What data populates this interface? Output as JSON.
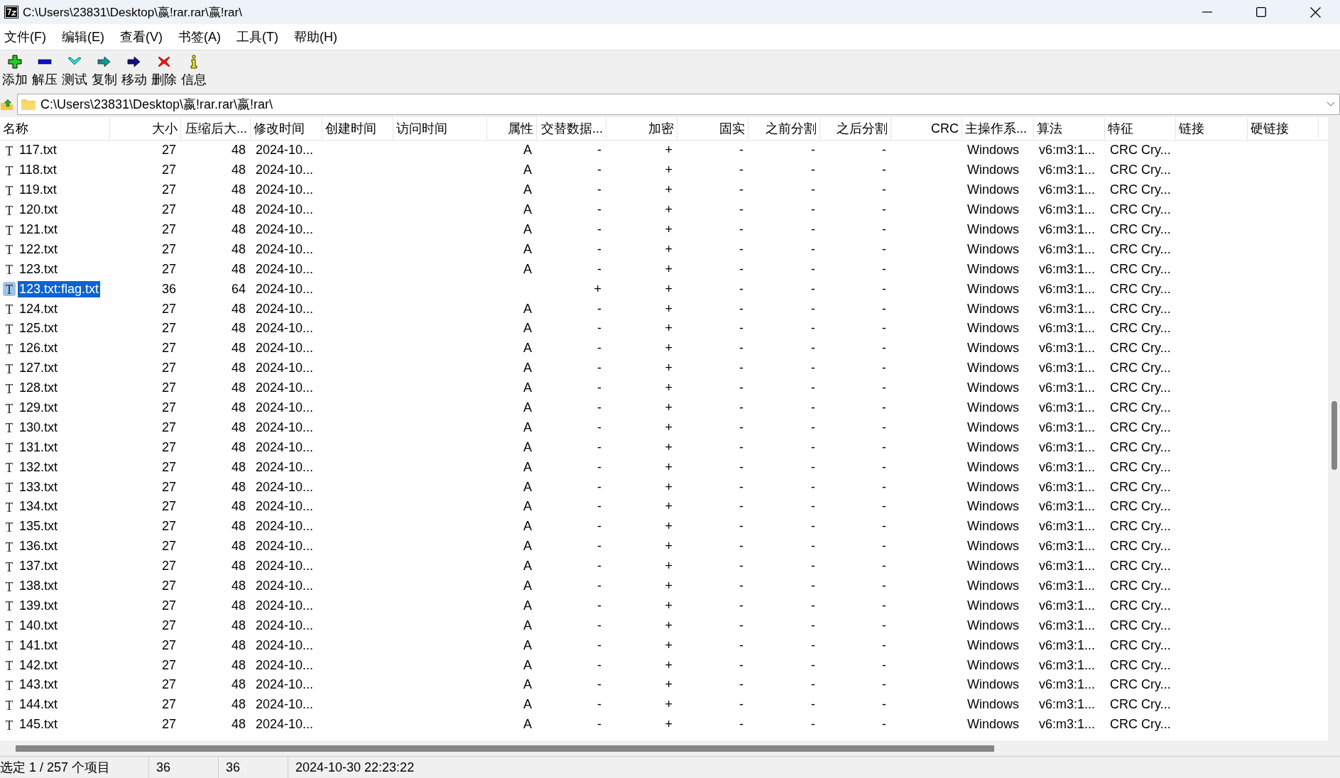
{
  "window": {
    "title": "C:\\Users\\23831\\Desktop\\嬴!rar.rar\\嬴!rar\\"
  },
  "menu": [
    "文件(F)",
    "编辑(E)",
    "查看(V)",
    "书签(A)",
    "工具(T)",
    "帮助(H)"
  ],
  "toolbar": [
    {
      "kind": "add",
      "label": "添加"
    },
    {
      "kind": "extract",
      "label": "解压"
    },
    {
      "kind": "test",
      "label": "测试"
    },
    {
      "kind": "copy",
      "label": "复制"
    },
    {
      "kind": "move",
      "label": "移动"
    },
    {
      "kind": "delete",
      "label": "删除"
    },
    {
      "kind": "info",
      "label": "信息"
    }
  ],
  "address": {
    "value": "C:\\Users\\23831\\Desktop\\嬴!rar.rar\\嬴!rar\\"
  },
  "table": {
    "columns": [
      "名称",
      "大小",
      "压缩后大...",
      "修改时间",
      "创建时间",
      "访问时间",
      "属性",
      "交替数据...",
      "加密",
      "固实",
      "之前分割",
      "之后分割",
      "CRC",
      "主操作系...",
      "算法",
      "特征",
      "链接",
      "硬链接"
    ],
    "rows": [
      {
        "name": "117.txt",
        "size": "27",
        "packed": "48",
        "modified": "2024-10...",
        "attributes": "A",
        "alternate": "-",
        "encrypted": "+",
        "solid": "-",
        "split_before": "-",
        "split_after": "-",
        "host_os": "Windows",
        "method": "v6:m3:1...",
        "characteristics": "CRC Cry...",
        "selected": false
      },
      {
        "name": "118.txt",
        "size": "27",
        "packed": "48",
        "modified": "2024-10...",
        "attributes": "A",
        "alternate": "-",
        "encrypted": "+",
        "solid": "-",
        "split_before": "-",
        "split_after": "-",
        "host_os": "Windows",
        "method": "v6:m3:1...",
        "characteristics": "CRC Cry...",
        "selected": false
      },
      {
        "name": "119.txt",
        "size": "27",
        "packed": "48",
        "modified": "2024-10...",
        "attributes": "A",
        "alternate": "-",
        "encrypted": "+",
        "solid": "-",
        "split_before": "-",
        "split_after": "-",
        "host_os": "Windows",
        "method": "v6:m3:1...",
        "characteristics": "CRC Cry...",
        "selected": false
      },
      {
        "name": "120.txt",
        "size": "27",
        "packed": "48",
        "modified": "2024-10...",
        "attributes": "A",
        "alternate": "-",
        "encrypted": "+",
        "solid": "-",
        "split_before": "-",
        "split_after": "-",
        "host_os": "Windows",
        "method": "v6:m3:1...",
        "characteristics": "CRC Cry...",
        "selected": false
      },
      {
        "name": "121.txt",
        "size": "27",
        "packed": "48",
        "modified": "2024-10...",
        "attributes": "A",
        "alternate": "-",
        "encrypted": "+",
        "solid": "-",
        "split_before": "-",
        "split_after": "-",
        "host_os": "Windows",
        "method": "v6:m3:1...",
        "characteristics": "CRC Cry...",
        "selected": false
      },
      {
        "name": "122.txt",
        "size": "27",
        "packed": "48",
        "modified": "2024-10...",
        "attributes": "A",
        "alternate": "-",
        "encrypted": "+",
        "solid": "-",
        "split_before": "-",
        "split_after": "-",
        "host_os": "Windows",
        "method": "v6:m3:1...",
        "characteristics": "CRC Cry...",
        "selected": false
      },
      {
        "name": "123.txt",
        "size": "27",
        "packed": "48",
        "modified": "2024-10...",
        "attributes": "A",
        "alternate": "-",
        "encrypted": "+",
        "solid": "-",
        "split_before": "-",
        "split_after": "-",
        "host_os": "Windows",
        "method": "v6:m3:1...",
        "characteristics": "CRC Cry...",
        "selected": false
      },
      {
        "name": "123.txt:flag.txt",
        "size": "36",
        "packed": "64",
        "modified": "2024-10...",
        "alternate": "+",
        "encrypted": "+",
        "solid": "-",
        "split_before": "-",
        "split_after": "-",
        "host_os": "Windows",
        "method": "v6:m3:1...",
        "characteristics": "CRC Cry...",
        "selected": true
      },
      {
        "name": "124.txt",
        "size": "27",
        "packed": "48",
        "modified": "2024-10...",
        "attributes": "A",
        "alternate": "-",
        "encrypted": "+",
        "solid": "-",
        "split_before": "-",
        "split_after": "-",
        "host_os": "Windows",
        "method": "v6:m3:1...",
        "characteristics": "CRC Cry...",
        "selected": false
      },
      {
        "name": "125.txt",
        "size": "27",
        "packed": "48",
        "modified": "2024-10...",
        "attributes": "A",
        "alternate": "-",
        "encrypted": "+",
        "solid": "-",
        "split_before": "-",
        "split_after": "-",
        "host_os": "Windows",
        "method": "v6:m3:1...",
        "characteristics": "CRC Cry...",
        "selected": false
      },
      {
        "name": "126.txt",
        "size": "27",
        "packed": "48",
        "modified": "2024-10...",
        "attributes": "A",
        "alternate": "-",
        "encrypted": "+",
        "solid": "-",
        "split_before": "-",
        "split_after": "-",
        "host_os": "Windows",
        "method": "v6:m3:1...",
        "characteristics": "CRC Cry...",
        "selected": false
      },
      {
        "name": "127.txt",
        "size": "27",
        "packed": "48",
        "modified": "2024-10...",
        "attributes": "A",
        "alternate": "-",
        "encrypted": "+",
        "solid": "-",
        "split_before": "-",
        "split_after": "-",
        "host_os": "Windows",
        "method": "v6:m3:1...",
        "characteristics": "CRC Cry...",
        "selected": false
      },
      {
        "name": "128.txt",
        "size": "27",
        "packed": "48",
        "modified": "2024-10...",
        "attributes": "A",
        "alternate": "-",
        "encrypted": "+",
        "solid": "-",
        "split_before": "-",
        "split_after": "-",
        "host_os": "Windows",
        "method": "v6:m3:1...",
        "characteristics": "CRC Cry...",
        "selected": false
      },
      {
        "name": "129.txt",
        "size": "27",
        "packed": "48",
        "modified": "2024-10...",
        "attributes": "A",
        "alternate": "-",
        "encrypted": "+",
        "solid": "-",
        "split_before": "-",
        "split_after": "-",
        "host_os": "Windows",
        "method": "v6:m3:1...",
        "characteristics": "CRC Cry...",
        "selected": false
      },
      {
        "name": "130.txt",
        "size": "27",
        "packed": "48",
        "modified": "2024-10...",
        "attributes": "A",
        "alternate": "-",
        "encrypted": "+",
        "solid": "-",
        "split_before": "-",
        "split_after": "-",
        "host_os": "Windows",
        "method": "v6:m3:1...",
        "characteristics": "CRC Cry...",
        "selected": false
      },
      {
        "name": "131.txt",
        "size": "27",
        "packed": "48",
        "modified": "2024-10...",
        "attributes": "A",
        "alternate": "-",
        "encrypted": "+",
        "solid": "-",
        "split_before": "-",
        "split_after": "-",
        "host_os": "Windows",
        "method": "v6:m3:1...",
        "characteristics": "CRC Cry...",
        "selected": false
      },
      {
        "name": "132.txt",
        "size": "27",
        "packed": "48",
        "modified": "2024-10...",
        "attributes": "A",
        "alternate": "-",
        "encrypted": "+",
        "solid": "-",
        "split_before": "-",
        "split_after": "-",
        "host_os": "Windows",
        "method": "v6:m3:1...",
        "characteristics": "CRC Cry...",
        "selected": false
      },
      {
        "name": "133.txt",
        "size": "27",
        "packed": "48",
        "modified": "2024-10...",
        "attributes": "A",
        "alternate": "-",
        "encrypted": "+",
        "solid": "-",
        "split_before": "-",
        "split_after": "-",
        "host_os": "Windows",
        "method": "v6:m3:1...",
        "characteristics": "CRC Cry...",
        "selected": false
      },
      {
        "name": "134.txt",
        "size": "27",
        "packed": "48",
        "modified": "2024-10...",
        "attributes": "A",
        "alternate": "-",
        "encrypted": "+",
        "solid": "-",
        "split_before": "-",
        "split_after": "-",
        "host_os": "Windows",
        "method": "v6:m3:1...",
        "characteristics": "CRC Cry...",
        "selected": false
      },
      {
        "name": "135.txt",
        "size": "27",
        "packed": "48",
        "modified": "2024-10...",
        "attributes": "A",
        "alternate": "-",
        "encrypted": "+",
        "solid": "-",
        "split_before": "-",
        "split_after": "-",
        "host_os": "Windows",
        "method": "v6:m3:1...",
        "characteristics": "CRC Cry...",
        "selected": false
      },
      {
        "name": "136.txt",
        "size": "27",
        "packed": "48",
        "modified": "2024-10...",
        "attributes": "A",
        "alternate": "-",
        "encrypted": "+",
        "solid": "-",
        "split_before": "-",
        "split_after": "-",
        "host_os": "Windows",
        "method": "v6:m3:1...",
        "characteristics": "CRC Cry...",
        "selected": false
      },
      {
        "name": "137.txt",
        "size": "27",
        "packed": "48",
        "modified": "2024-10...",
        "attributes": "A",
        "alternate": "-",
        "encrypted": "+",
        "solid": "-",
        "split_before": "-",
        "split_after": "-",
        "host_os": "Windows",
        "method": "v6:m3:1...",
        "characteristics": "CRC Cry...",
        "selected": false
      },
      {
        "name": "138.txt",
        "size": "27",
        "packed": "48",
        "modified": "2024-10...",
        "attributes": "A",
        "alternate": "-",
        "encrypted": "+",
        "solid": "-",
        "split_before": "-",
        "split_after": "-",
        "host_os": "Windows",
        "method": "v6:m3:1...",
        "characteristics": "CRC Cry...",
        "selected": false
      },
      {
        "name": "139.txt",
        "size": "27",
        "packed": "48",
        "modified": "2024-10...",
        "attributes": "A",
        "alternate": "-",
        "encrypted": "+",
        "solid": "-",
        "split_before": "-",
        "split_after": "-",
        "host_os": "Windows",
        "method": "v6:m3:1...",
        "characteristics": "CRC Cry...",
        "selected": false
      },
      {
        "name": "140.txt",
        "size": "27",
        "packed": "48",
        "modified": "2024-10...",
        "attributes": "A",
        "alternate": "-",
        "encrypted": "+",
        "solid": "-",
        "split_before": "-",
        "split_after": "-",
        "host_os": "Windows",
        "method": "v6:m3:1...",
        "characteristics": "CRC Cry...",
        "selected": false
      },
      {
        "name": "141.txt",
        "size": "27",
        "packed": "48",
        "modified": "2024-10...",
        "attributes": "A",
        "alternate": "-",
        "encrypted": "+",
        "solid": "-",
        "split_before": "-",
        "split_after": "-",
        "host_os": "Windows",
        "method": "v6:m3:1...",
        "characteristics": "CRC Cry...",
        "selected": false
      },
      {
        "name": "142.txt",
        "size": "27",
        "packed": "48",
        "modified": "2024-10...",
        "attributes": "A",
        "alternate": "-",
        "encrypted": "+",
        "solid": "-",
        "split_before": "-",
        "split_after": "-",
        "host_os": "Windows",
        "method": "v6:m3:1...",
        "characteristics": "CRC Cry...",
        "selected": false
      },
      {
        "name": "143.txt",
        "size": "27",
        "packed": "48",
        "modified": "2024-10...",
        "attributes": "A",
        "alternate": "-",
        "encrypted": "+",
        "solid": "-",
        "split_before": "-",
        "split_after": "-",
        "host_os": "Windows",
        "method": "v6:m3:1...",
        "characteristics": "CRC Cry...",
        "selected": false
      },
      {
        "name": "144.txt",
        "size": "27",
        "packed": "48",
        "modified": "2024-10...",
        "attributes": "A",
        "alternate": "-",
        "encrypted": "+",
        "solid": "-",
        "split_before": "-",
        "split_after": "-",
        "host_os": "Windows",
        "method": "v6:m3:1...",
        "characteristics": "CRC Cry...",
        "selected": false
      },
      {
        "name": "145.txt",
        "size": "27",
        "packed": "48",
        "modified": "2024-10...",
        "attributes": "A",
        "alternate": "-",
        "encrypted": "+",
        "solid": "-",
        "split_before": "-",
        "split_after": "-",
        "host_os": "Windows",
        "method": "v6:m3:1...",
        "characteristics": "CRC Cry...",
        "selected": false
      }
    ]
  },
  "status_bar": [
    "选定 1 / 257 个项目",
    "36",
    "36",
    "2024-10-30 22:23:22"
  ]
}
